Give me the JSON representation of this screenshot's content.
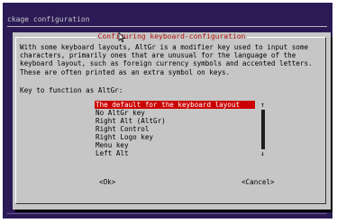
{
  "backtitle": "ckage configuration",
  "dialog": {
    "title": "Configuring keyboard-configuration",
    "message": "With some keyboard layouts, AltGr is a modifier key used to input some\ncharacters, primarily ones that are unusual for the language of the\nkeyboard layout, such as foreign currency symbols and accented letters.\nThese are often printed as an extra symbol on keys.",
    "prompt": "Key to function as AltGr:",
    "options": [
      "The default for the keyboard layout",
      "No AltGr key",
      "Right Alt (AltGr)",
      "Right Control",
      "Right Logo key",
      "Menu key",
      "Left Alt"
    ],
    "selected_index": 0,
    "ok_label": "<Ok>",
    "cancel_label": "<Cancel>",
    "scroll_up": "↑",
    "scroll_down": "↓"
  },
  "colors": {
    "terminal_bg": "#2a1a55",
    "dialog_bg": "#c6c6c6",
    "selection": "#cc0000"
  },
  "icons": [
    "scroll-up-icon",
    "scroll-down-icon",
    "mouse-cursor-icon"
  ]
}
